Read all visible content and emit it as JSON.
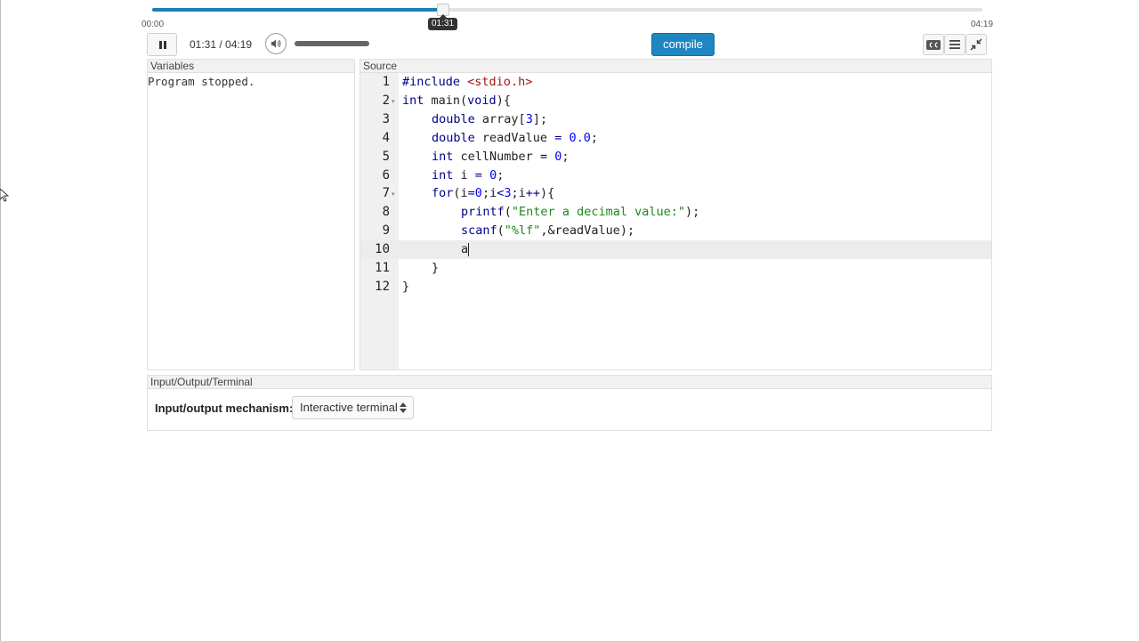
{
  "player": {
    "time_start": "00:00",
    "time_end": "04:19",
    "tooltip": "01:31",
    "time_readout": "01:31 / 04:19",
    "progress_percent": 35.1,
    "volume_percent": 100
  },
  "toolbar": {
    "compile_label": "compile",
    "cc_icon": "closed-captions-icon",
    "menu_icon": "menu-icon",
    "collapse_icon": "collapse-icon"
  },
  "variables": {
    "title": "Variables",
    "status": "Program stopped."
  },
  "source": {
    "title": "Source",
    "active_line": 10,
    "lines": [
      {
        "n": "1",
        "fold": false,
        "indent": 0,
        "parts": [
          [
            "kw",
            "#include"
          ],
          [
            "",
            " "
          ],
          [
            "inc",
            "<stdio.h>"
          ]
        ]
      },
      {
        "n": "2",
        "fold": true,
        "indent": 0,
        "parts": [
          [
            "kw",
            "int"
          ],
          [
            "",
            " main("
          ],
          [
            "kw",
            "void"
          ],
          [
            "",
            "){"
          ]
        ]
      },
      {
        "n": "3",
        "fold": false,
        "indent": 1,
        "parts": [
          [
            "kw",
            "double"
          ],
          [
            "",
            " array["
          ],
          [
            "num",
            "3"
          ],
          [
            "",
            "];"
          ]
        ]
      },
      {
        "n": "4",
        "fold": false,
        "indent": 1,
        "parts": [
          [
            "kw",
            "double"
          ],
          [
            "",
            " readValue "
          ],
          [
            "kw",
            "="
          ],
          [
            "",
            " "
          ],
          [
            "num",
            "0.0"
          ],
          [
            "",
            ";"
          ]
        ]
      },
      {
        "n": "5",
        "fold": false,
        "indent": 1,
        "parts": [
          [
            "kw",
            "int"
          ],
          [
            "",
            " cellNumber "
          ],
          [
            "kw",
            "="
          ],
          [
            "",
            " "
          ],
          [
            "num",
            "0"
          ],
          [
            "",
            ";"
          ]
        ]
      },
      {
        "n": "6",
        "fold": false,
        "indent": 1,
        "parts": [
          [
            "kw",
            "int"
          ],
          [
            "",
            " i "
          ],
          [
            "kw",
            "="
          ],
          [
            "",
            " "
          ],
          [
            "num",
            "0"
          ],
          [
            "",
            ";"
          ]
        ]
      },
      {
        "n": "7",
        "fold": true,
        "indent": 1,
        "parts": [
          [
            "kw",
            "for"
          ],
          [
            "",
            "(i"
          ],
          [
            "kw",
            "="
          ],
          [
            "num",
            "0"
          ],
          [
            "",
            ";i"
          ],
          [
            "kw",
            "<"
          ],
          [
            "num",
            "3"
          ],
          [
            "",
            ";i"
          ],
          [
            "kw",
            "++"
          ],
          [
            "",
            "){"
          ]
        ]
      },
      {
        "n": "8",
        "fold": false,
        "indent": 2,
        "parts": [
          [
            "kw",
            "printf"
          ],
          [
            "",
            "("
          ],
          [
            "str",
            "\"Enter a decimal value:\""
          ],
          [
            "",
            ");"
          ]
        ]
      },
      {
        "n": "9",
        "fold": false,
        "indent": 2,
        "parts": [
          [
            "kw",
            "scanf"
          ],
          [
            "",
            "("
          ],
          [
            "str",
            "\"%lf\""
          ],
          [
            "",
            ",&readValue);"
          ]
        ]
      },
      {
        "n": "10",
        "fold": false,
        "indent": 2,
        "parts": [
          [
            "",
            "a"
          ]
        ]
      },
      {
        "n": "11",
        "fold": false,
        "indent": 1,
        "parts": [
          [
            "",
            "}"
          ]
        ]
      },
      {
        "n": "12",
        "fold": false,
        "indent": 0,
        "parts": [
          [
            "",
            "}"
          ]
        ]
      }
    ]
  },
  "io": {
    "title": "Input/Output/Terminal",
    "label": "Input/output mechanism:",
    "selected": "Interactive terminal"
  }
}
